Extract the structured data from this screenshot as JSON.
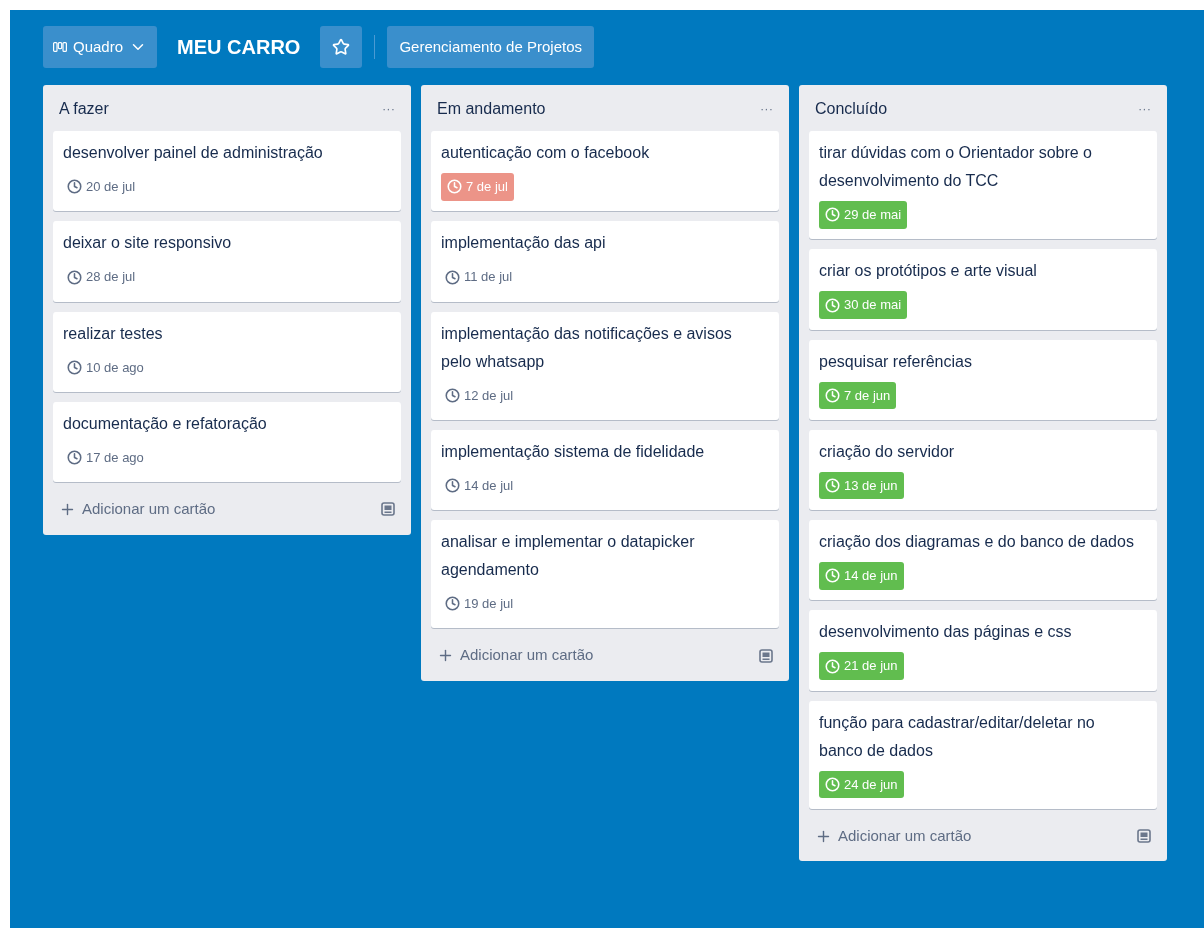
{
  "header": {
    "view_button": "Quadro",
    "board_title": "MEU CARRO",
    "starred": false,
    "team_button": "Gerenciamento de Projetos"
  },
  "lists": [
    {
      "title": "A fazer",
      "menu": "···",
      "add_card": "Adicionar um cartão",
      "cards": [
        {
          "title": "desenvolver painel de administração",
          "due": "20 de jul",
          "kind": "pending"
        },
        {
          "title": "deixar o site responsivo",
          "due": "28 de jul",
          "kind": "pending"
        },
        {
          "title": "realizar testes",
          "due": "10 de ago",
          "kind": "pending"
        },
        {
          "title": "documentação e refatoração",
          "due": "17 de ago",
          "kind": "pending"
        }
      ]
    },
    {
      "title": "Em andamento",
      "menu": "···",
      "add_card": "Adicionar um cartão",
      "cards": [
        {
          "title": "autenticação com o facebook",
          "due": "7 de jul",
          "kind": "overdue"
        },
        {
          "title": "implementação das api",
          "due": "11 de jul",
          "kind": "pending"
        },
        {
          "title": "implementação das notificações e avisos pelo whatsapp",
          "due": "12 de jul",
          "kind": "pending"
        },
        {
          "title": "implementação sistema de fidelidade",
          "due": "14 de jul",
          "kind": "pending"
        },
        {
          "title": "analisar e implementar o datapicker agendamento",
          "due": "19 de jul",
          "kind": "pending"
        }
      ]
    },
    {
      "title": "Concluído",
      "menu": "···",
      "add_card": "Adicionar um cartão",
      "cards": [
        {
          "title": "tirar dúvidas com o Orientador sobre o desenvolvimento do TCC",
          "due": "29 de mai",
          "kind": "complete"
        },
        {
          "title": "criar os protótipos e arte visual",
          "due": "30 de mai",
          "kind": "complete"
        },
        {
          "title": "pesquisar referências",
          "due": "7 de jun",
          "kind": "complete"
        },
        {
          "title": "criação do servidor",
          "due": "13 de jun",
          "kind": "complete"
        },
        {
          "title": "criação dos diagramas e do banco de dados",
          "due": "14 de jun",
          "kind": "complete"
        },
        {
          "title": "desenvolvimento das páginas e css",
          "due": "21 de jun",
          "kind": "complete"
        },
        {
          "title": "função para cadastrar/editar/deletar no banco de dados",
          "due": "24 de jun",
          "kind": "complete"
        }
      ]
    }
  ]
}
